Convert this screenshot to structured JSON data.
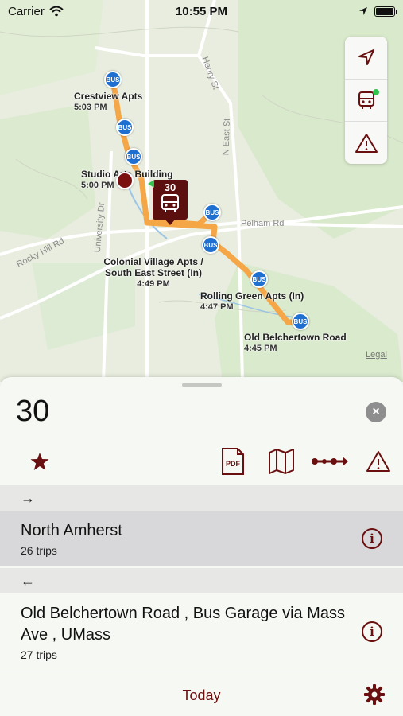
{
  "status_bar": {
    "carrier": "Carrier",
    "time": "10:55 PM"
  },
  "map": {
    "streets": [
      "Henry St",
      "N East St",
      "Pelham Rd",
      "University Dr",
      "Rocky Hill Rd"
    ],
    "stops": [
      {
        "name": "Crestview Apts",
        "time": "5:03 PM"
      },
      {
        "name": "Studio Arts Building",
        "time": "5:00 PM"
      },
      {
        "name": "Colonial Village Apts / South East Street (In)",
        "time": "4:49 PM"
      },
      {
        "name": "Rolling Green Apts (In)",
        "time": "4:47 PM"
      },
      {
        "name": "Old Belchertown Road",
        "time": "4:45 PM"
      }
    ],
    "bus_stop_label": "BUS",
    "bus_marker_route": "30",
    "legal": "Legal",
    "controls": [
      "location-arrow-icon",
      "bus-icon",
      "warning-icon"
    ]
  },
  "sheet": {
    "route_number": "30",
    "close": "×",
    "toolbar": [
      "star-icon",
      "pdf-icon",
      "map-icon",
      "timeline-icon",
      "warning-icon"
    ],
    "pdf_label": "PDF",
    "sections": [
      {
        "arrow": "→",
        "destination": "North Amherst",
        "trips": "26 trips"
      },
      {
        "arrow": "←",
        "destination": "Old Belchertown Road , Bus Garage via Mass Ave , UMass",
        "trips": "27 trips"
      }
    ],
    "footer_label": "Today"
  },
  "colors": {
    "accent": "#6a0f0f",
    "route": "#f5a647",
    "stop_blue": "#1f6fd1"
  }
}
